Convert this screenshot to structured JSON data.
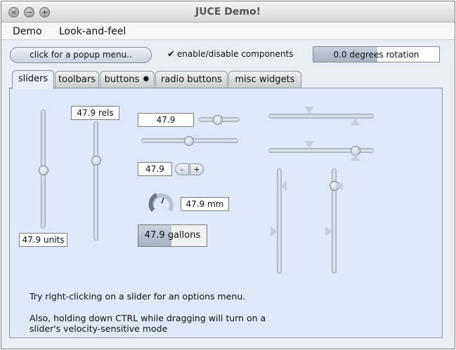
{
  "window": {
    "title": "JUCE Demo!",
    "buttons": [
      "×",
      "−",
      "+"
    ]
  },
  "menubar": {
    "items": [
      "Demo",
      "Look-and-feel"
    ]
  },
  "toolbar": {
    "popup_button": "click for a popup menu..",
    "checkbox_label": "enable/disable components",
    "checkbox_checked": true,
    "rotation_value": "0.0 degrees rotation",
    "rotation_fraction": 0.5
  },
  "tabs": [
    {
      "label": "sliders",
      "active": true
    },
    {
      "label": "toolbars",
      "active": false
    },
    {
      "label": "buttons",
      "active": false,
      "icon": "star-burst-icon"
    },
    {
      "label": "radio buttons",
      "active": false
    },
    {
      "label": "misc widgets",
      "active": false
    }
  ],
  "sliders": {
    "vertical_units": "47.9 units",
    "vertical_rels": "47.9 rels",
    "horizontal_value": "47.9",
    "inc_dec_value": "47.9",
    "inc_dec_minus": "-",
    "inc_dec_plus": "+",
    "rotary_value": "47.9 mm",
    "gallons_value": "47.9 gallons",
    "value_fraction": 0.479
  },
  "info": {
    "line1": "Try right-clicking on a slider for an options menu.",
    "line2": "Also, holding down CTRL while dragging will turn on a",
    "line3": "slider's velocity-sensitive mode"
  },
  "colors": {
    "panel": "#dfe8f6",
    "tab_active": "#e8eef7",
    "slider_fill": "#a9b3c2"
  }
}
